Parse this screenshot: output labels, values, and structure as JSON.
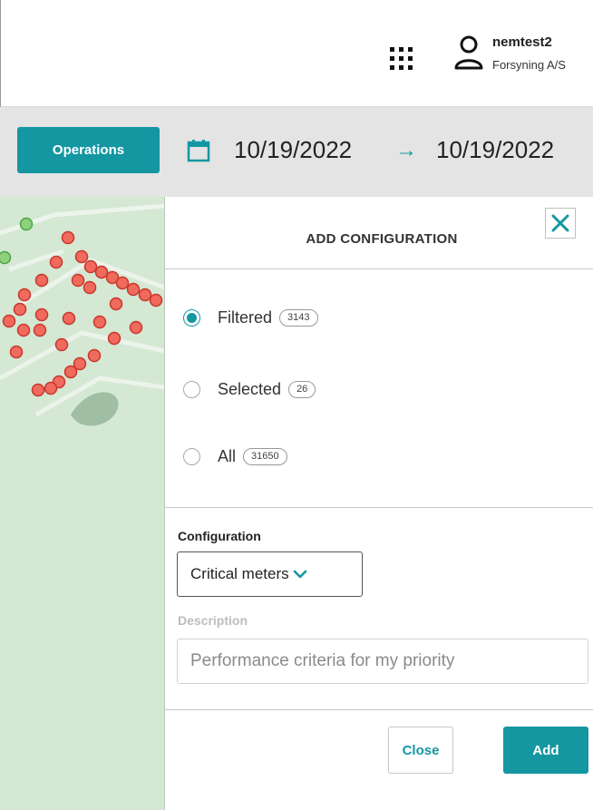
{
  "header": {
    "user_name": "nemtest2",
    "organization": "Forsyning A/S",
    "apps_icon": "grid-apps-icon",
    "user_icon": "user-icon"
  },
  "toolbar": {
    "operations_label": "Operations",
    "date_from": "10/19/2022",
    "arrow": "→",
    "date_to": "10/19/2022",
    "calendar_icon": "calendar-icon"
  },
  "dialog": {
    "title": "ADD CONFIGURATION",
    "close_icon": "close-icon",
    "options": [
      {
        "label": "Filtered",
        "count": "3143",
        "selected": true
      },
      {
        "label": "Selected",
        "count": "26",
        "selected": false
      },
      {
        "label": "All",
        "count": "31650",
        "selected": false
      }
    ],
    "configuration_label": "Configuration",
    "configuration_value": "Critical meters",
    "description_label": "Description",
    "description_placeholder": "Performance criteria for my priority",
    "close_button": "Close",
    "add_button": "Add"
  },
  "colors": {
    "accent": "#1597a2",
    "map_background": "#d4e8d3",
    "map_marker_red": "#f06a5e",
    "map_marker_green": "#8fd07d"
  }
}
